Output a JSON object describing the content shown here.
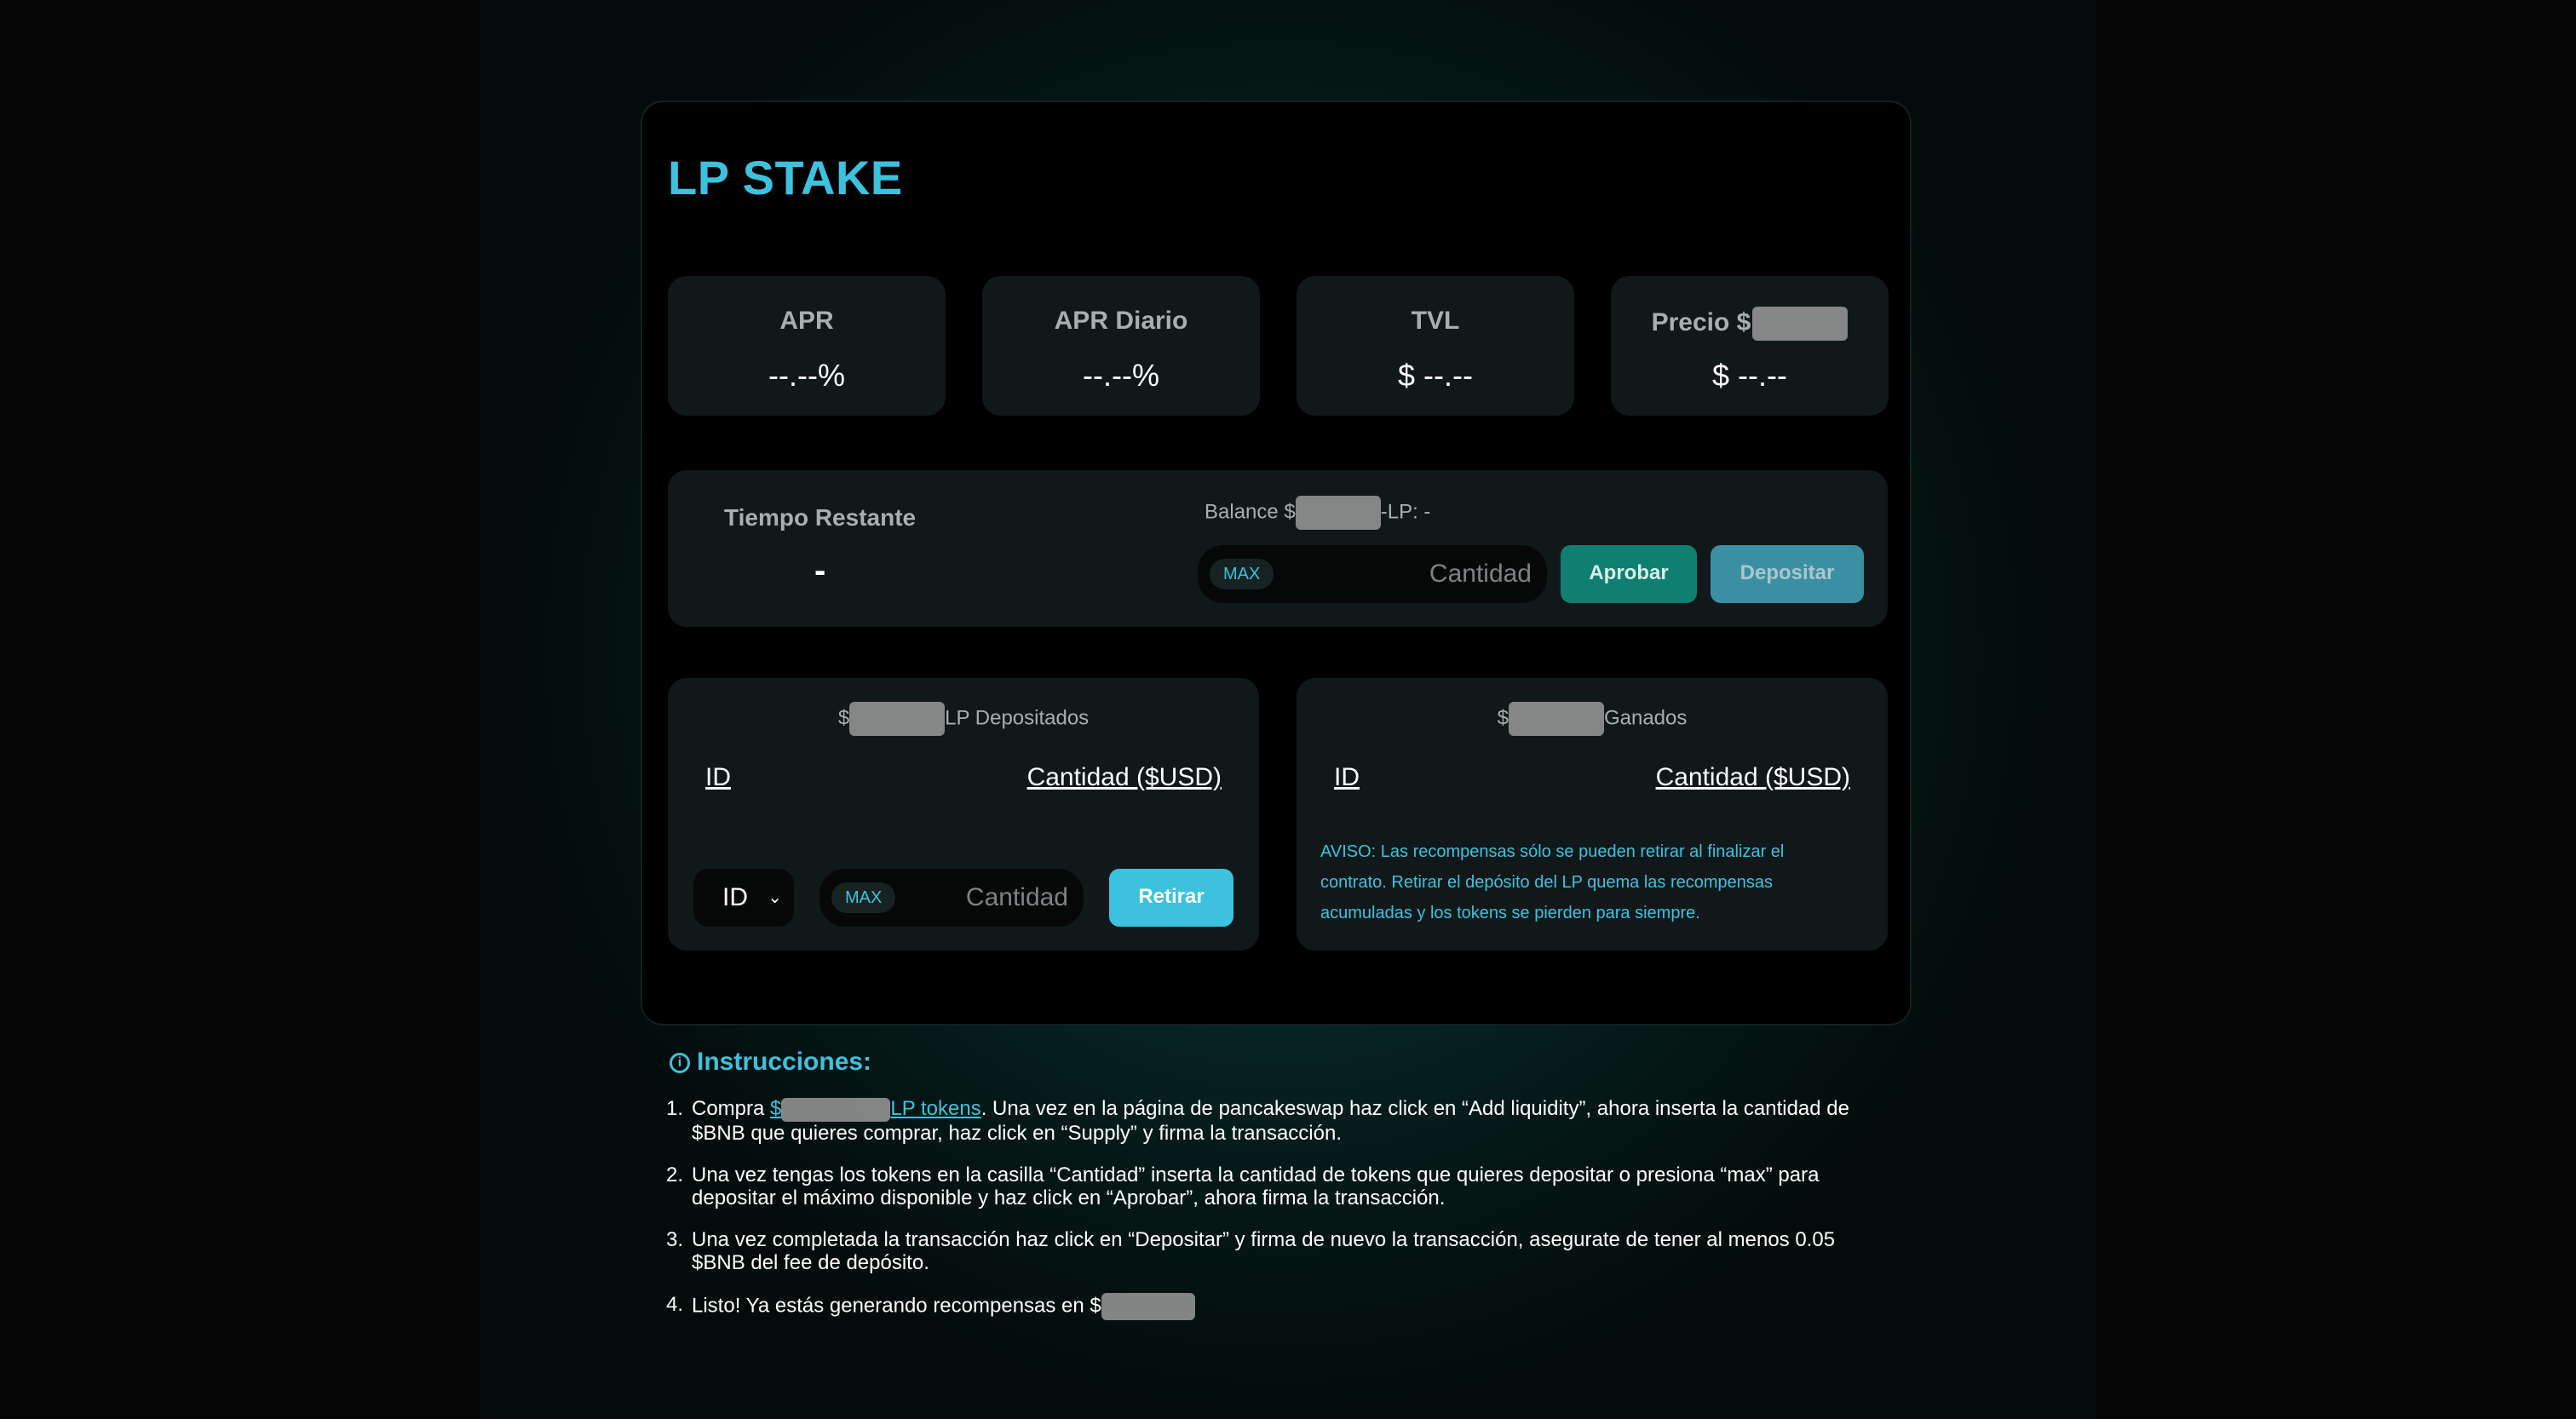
{
  "app": {
    "title": "LP STAKE"
  },
  "stats": [
    {
      "label": "APR",
      "value": "--.--%"
    },
    {
      "label": "APR Diario",
      "value": "--.--%"
    },
    {
      "label": "TVL",
      "value": "$ --.--"
    },
    {
      "label": "Precio $",
      "value": "$ --.--"
    }
  ],
  "stake": {
    "time_label": "Tiempo Restante",
    "time_value": "-",
    "balance_prefix": "Balance $",
    "balance_suffix": "-LP: -",
    "max_label": "MAX",
    "amount_placeholder": "Cantidad",
    "approve_label": "Aprobar",
    "deposit_label": "Depositar"
  },
  "deposited": {
    "title_prefix": "$",
    "title_suffix": "LP Depositados",
    "col_id": "ID",
    "col_amount": "Cantidad ($USD)",
    "select_value": "ID",
    "max_label": "MAX",
    "amount_placeholder": "Cantidad",
    "withdraw_label": "Retirar"
  },
  "earned": {
    "title_prefix": "$",
    "title_suffix": "Ganados",
    "col_id": "ID",
    "col_amount": "Cantidad ($USD)",
    "notice": "AVISO: Las recompensas sólo se pueden retirar al finalizar el contrato. Retirar el depósito del LP quema las recompensas acumuladas y los tokens se pierden para siempre."
  },
  "instructions": {
    "title": "Instrucciones:",
    "step1_before": "Compra ",
    "step1_link_prefix": "$",
    "step1_link_suffix": "LP tokens",
    "step1_after": ". Una vez en la página de pancakeswap haz click en “Add liquidity”, ahora inserta la cantidad de $BNB que quieres comprar, haz click en “Supply” y firma la transacción.",
    "step2": "Una vez tengas los tokens en la casilla “Cantidad” inserta la cantidad de tokens que quieres depositar o presiona “max” para depositar el máximo disponible y haz click en “Aprobar”, ahora firma la transacción.",
    "step3": "Una vez completada la transacción haz click en “Depositar” y firma de nuevo la transacción, asegurate de tener al menos 0.05 $BNB del fee de depósito.",
    "step4": "Listo! Ya estás generando recompensas en $",
    "numbers": [
      "1.",
      "2.",
      "3.",
      "4."
    ]
  },
  "colors": {
    "accent": "#3cc2df",
    "approve": "#0f7f72",
    "deposit": "#3a8fa3",
    "panel": "#101819"
  }
}
